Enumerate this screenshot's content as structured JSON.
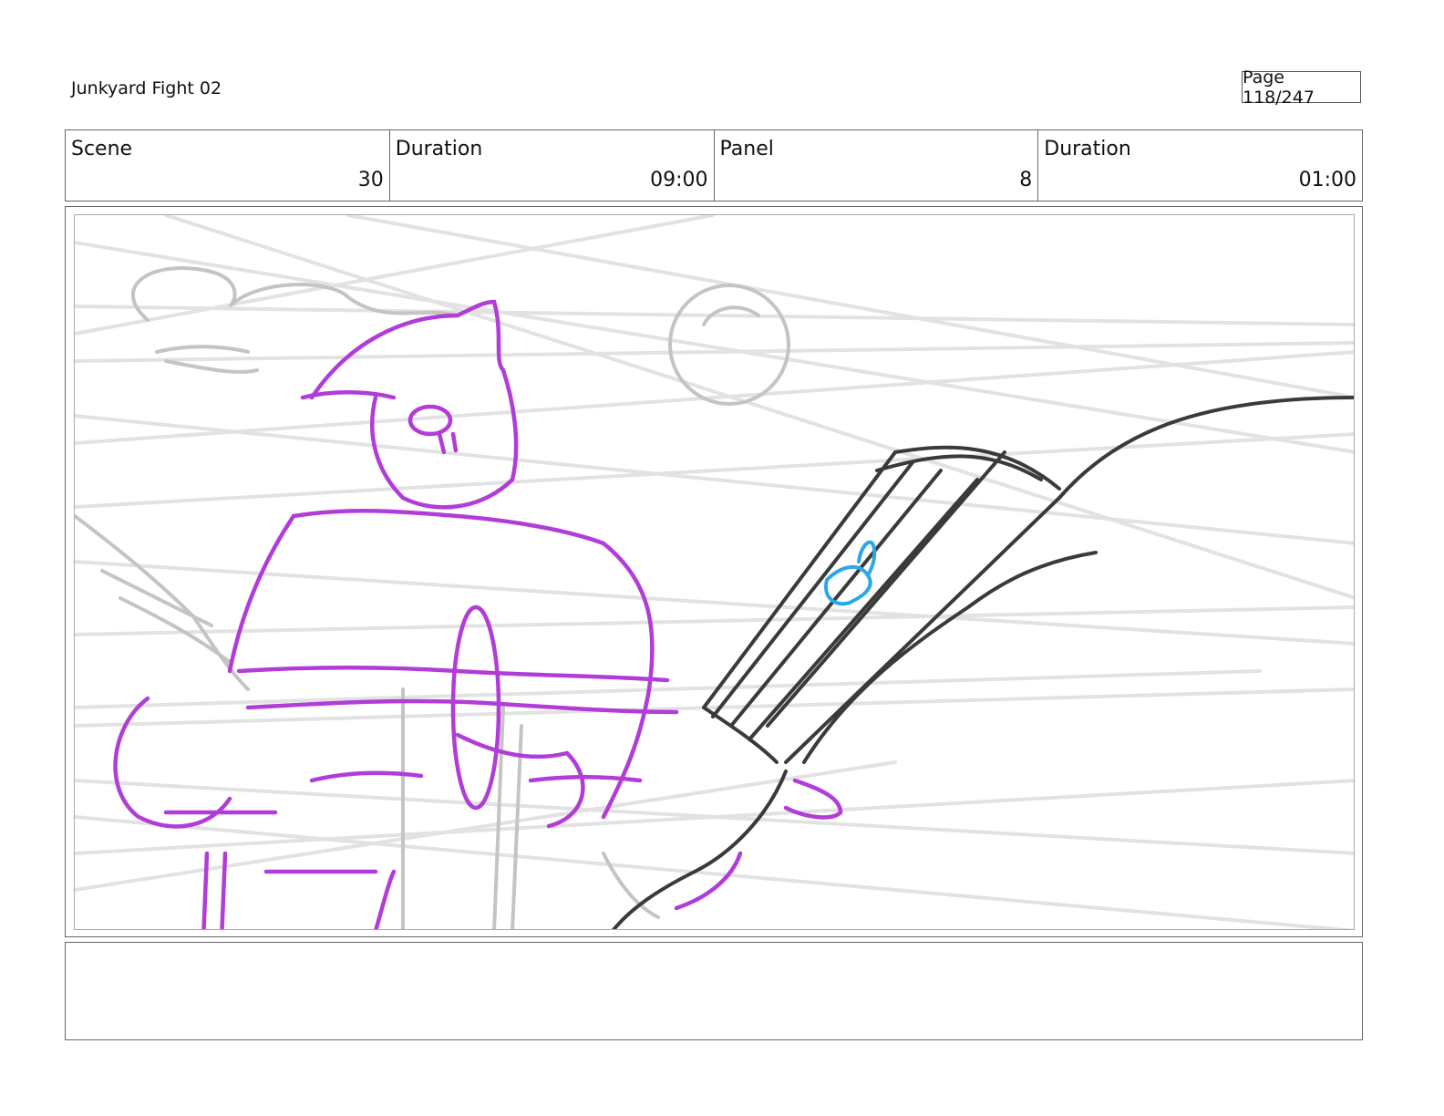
{
  "header": {
    "project_title": "Junkyard Fight 02",
    "page_label": "Page 118/247"
  },
  "info": {
    "scene_label": "Scene",
    "scene_value": "30",
    "scene_duration_label": "Duration",
    "scene_duration_value": "09:00",
    "panel_label": "Panel",
    "panel_value": "8",
    "panel_duration_label": "Duration",
    "panel_duration_value": "01:00"
  },
  "sketch": {
    "colors": {
      "background_lines": "#dddddd",
      "rough_gray": "#c4c4c4",
      "character": "#b23cd8",
      "pipe": "#3a3a3a",
      "detail": "#2aa7e8"
    }
  },
  "notes": {
    "text": ""
  }
}
